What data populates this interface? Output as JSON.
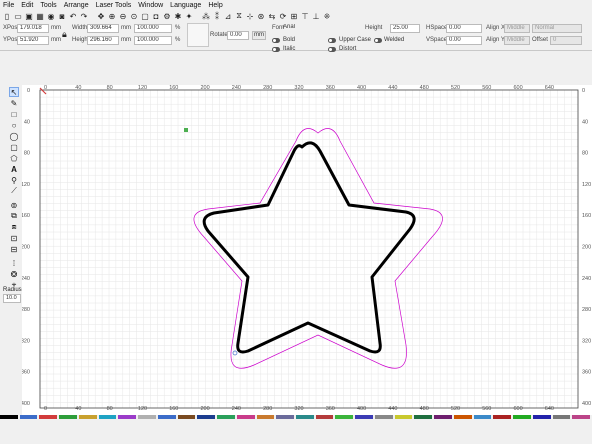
{
  "menu": [
    "File",
    "Edit",
    "Tools",
    "Arrange",
    "Laser Tools",
    "Window",
    "Language",
    "Help"
  ],
  "toolbar_icons": [
    "new-file-icon",
    "open-file-icon",
    "save-icon",
    "print-icon",
    "camera-icon",
    "settings-icon",
    "undo-icon",
    "redo-icon",
    "pan-icon",
    "zoom-in-icon",
    "zoom-out-icon",
    "zoom-fit-icon",
    "frame-icon",
    "camera-capture-icon",
    "gear-icon",
    "tools-icon",
    "wand-icon",
    "group-icon",
    "ungroup-icon",
    "align-icon",
    "flip-icon",
    "path-icon",
    "crosshair-icon",
    "distribute-icon",
    "rotate-icon",
    "grid-icon",
    "align-h-icon",
    "align-v-icon",
    "nudge-icon"
  ],
  "props": {
    "xpos_label": "XPos",
    "xpos_value": "179.018",
    "ypos_label": "YPos",
    "ypos_value": "51.920",
    "width_label": "Width",
    "width_value": "309.664",
    "height_label": "Height",
    "height_value": "296.160",
    "unit_mm": "mm",
    "scale_w": "100.000",
    "scale_h": "100.000",
    "pct": "%",
    "rotate_label": "Rotate",
    "rotate_value": "0.00",
    "mm_button": "mm"
  },
  "text": {
    "font_label": "Font",
    "font_value": "Arial",
    "height_label": "Height",
    "height_value": "25.00",
    "bold": "Bold",
    "italic": "Italic",
    "upper_case": "Upper Case",
    "distort": "Distort",
    "welded": "Welded",
    "hspace_label": "HSpace",
    "hspace_value": "0.00",
    "vspace_label": "VSpace",
    "vspace_value": "0.00",
    "alignx_label": "Align X",
    "alignx_value": "Middle",
    "aligny_label": "Align Y",
    "aligny_value": "Middle",
    "normal": "Normal",
    "offset_label": "Offset",
    "offset_value": "0"
  },
  "sidebar": {
    "radius_label": "Radius:",
    "radius_value": "10.0"
  },
  "ruler": {
    "x_ticks": [
      0,
      40,
      80,
      120,
      160,
      200,
      240,
      280,
      320,
      360,
      400,
      440,
      480,
      520,
      560,
      600,
      640
    ],
    "y_ticks": [
      0,
      40,
      80,
      120,
      160,
      200,
      240,
      280,
      320,
      360,
      400
    ]
  },
  "palette": [
    "#000000",
    "#3b6cc9",
    "#d23b3b",
    "#2e9e3a",
    "#c9a12e",
    "#1fa3c4",
    "#9b3bc9",
    "#b0b0b0",
    "#3b6cc9",
    "#7a4a20",
    "#1c3d8f",
    "#2aa05a",
    "#c93b8a",
    "#c97a2e",
    "#6b6b9b",
    "#2a8a8a",
    "#b43b3b",
    "#3bb43b",
    "#3b3bb4",
    "#888888",
    "#c9c92e",
    "#1f6f3f",
    "#6f1f6f",
    "#cc5500",
    "#3b8ac9",
    "#aa2222",
    "#22aa22",
    "#2222aa",
    "#777777",
    "#bb4488"
  ],
  "colors": {
    "accent": "#cc00cc",
    "shape": "#000000",
    "grid_minor": "#e6e6e6",
    "grid_major": "#c8c8c8"
  }
}
